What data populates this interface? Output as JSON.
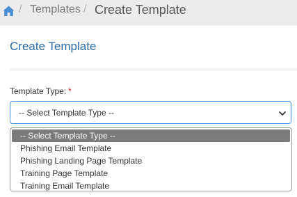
{
  "breadcrumb": {
    "home_icon": "home-icon",
    "separator": "/",
    "items": [
      {
        "label": "Templates"
      },
      {
        "label": "Create Template"
      }
    ]
  },
  "card": {
    "title": "Create Template",
    "field": {
      "label": "Template Type:",
      "required_mark": "*",
      "selected_value": "-- Select Template Type --",
      "options": [
        {
          "label": "-- Select Template Type --",
          "selected": true
        },
        {
          "label": "Phishing Email Template"
        },
        {
          "label": "Phishing Landing Page Template"
        },
        {
          "label": "Training Page Template"
        },
        {
          "label": "Training Email Template"
        }
      ]
    }
  },
  "colors": {
    "accent": "#2a6aa8",
    "required": "#e02424",
    "focus_border": "#4a90d9",
    "selected_option_bg": "#7b7b7b"
  }
}
